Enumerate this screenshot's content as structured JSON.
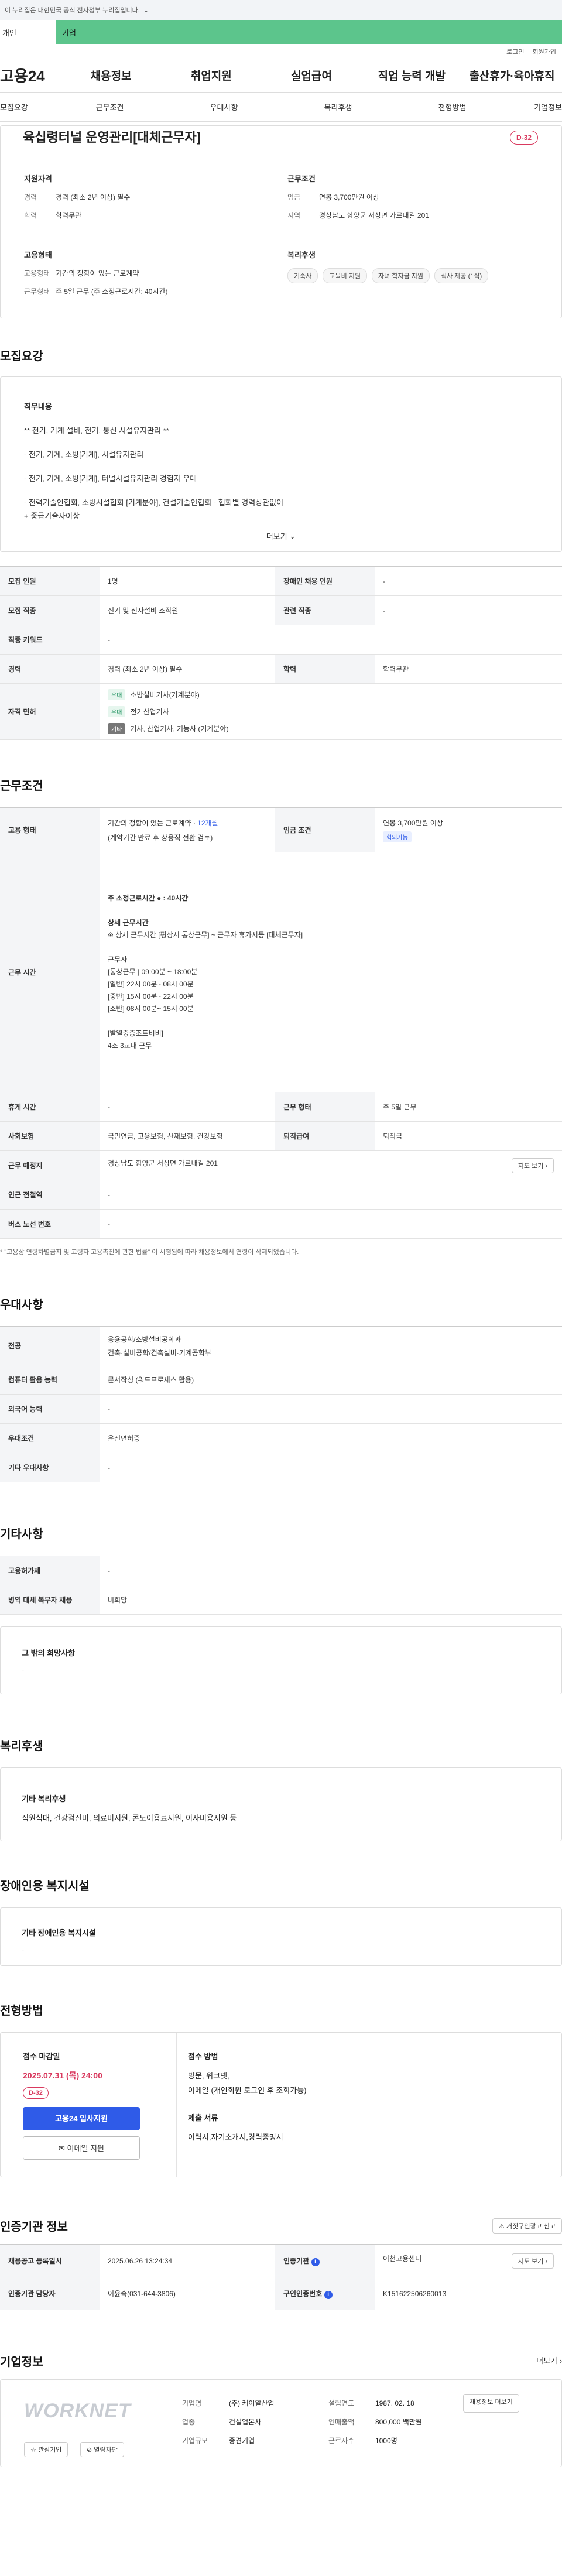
{
  "gov_banner": {
    "text": "이 누리집은 대한민국 공식 전자정부 누리집입니다.",
    "expand": "⌄"
  },
  "top_tabs": [
    "개인",
    "기업"
  ],
  "util": [
    "로그인",
    "회원가입"
  ],
  "logo": "고용24",
  "gnb": [
    "채용정보",
    "취업지원",
    "실업급여",
    "직업 능력 개발",
    "출산휴가·육아휴직"
  ],
  "subnav": [
    "모집요강",
    "근무조건",
    "우대사항",
    "복리후생",
    "전형방법",
    "기업정보"
  ],
  "summary": {
    "title": "육십령터널 운영관리[대체근무자]",
    "dday": "D-32",
    "qual": {
      "heading": "지원자격",
      "career_k": "경력",
      "career_v": "경력 (최소 2년 이상) 필수",
      "edu_k": "학력",
      "edu_v": "학력무관"
    },
    "cond": {
      "heading": "근무조건",
      "wage_k": "임금",
      "wage_v": "연봉 3,700만원 이상",
      "area_k": "지역",
      "area_v": "경상남도 함양군 서상면 가르내길 201"
    },
    "emp": {
      "heading": "고용형태",
      "type_k": "고용형태",
      "type_v": "기간의 정함이 있는 근로계약",
      "form_k": "근무형태",
      "form_v": "주 5일 근무 (주 소정근로시간: 40시간)"
    },
    "welfare": {
      "heading": "복리후생",
      "chips": [
        "기숙사",
        "교육비 지원",
        "자녀 학자금 지원",
        "식사 제공 (1식)"
      ]
    }
  },
  "desc": {
    "title": "모집요강",
    "heading": "직무내용",
    "lines": [
      "** 전기, 기계 설비, 전기, 통신 시설유지관리 **",
      "- 전기, 기계, 소방[기계], 시설유지관리",
      "- 전기, 기계, 소방[기계], 터널시설유지관리 경험자 우대",
      "- 전력기술인협회, 소방시설협회 [기계분야], 건설기술인협회 - 협회별 경력상관없이",
      "+ 중급기술자이상"
    ],
    "more": "더보기"
  },
  "recruit": {
    "count_h": "모집 인원",
    "count_v": "1명",
    "dis_h": "장애인 채용 인원",
    "dis_v": "-",
    "job_h": "모집 직종",
    "job_v": "전기 및 전자설비 조작원",
    "rel_h": "관련 직종",
    "rel_v": "-",
    "kw_h": "직종 키워드",
    "kw_v": "-",
    "career_h": "경력",
    "career_v": "경력 (최소 2년 이상) 필수",
    "edu_h": "학력",
    "edu_v": "학력무관",
    "lic_h": "자격 면허",
    "licenses": [
      {
        "tag": "우대",
        "name": "소방설비기사(기계분야)"
      },
      {
        "tag": "우대",
        "name": "전기산업기사"
      },
      {
        "tag": "기타",
        "name": "기사, 산업기사, 기능사 (기계분야)"
      }
    ]
  },
  "work": {
    "title": "근무조건",
    "emp_h": "고용 형태",
    "emp_v1": "기간의 정함이 있는 근로계약 · ",
    "emp_months": "12개월",
    "emp_v2": "(계약기간 만료 후 상용직 전환 검토)",
    "wage_h": "임금 조건",
    "wage_v": "연봉 3,700만원 이상",
    "wage_badge": "협의가능",
    "time_h": "근무 시간",
    "time_lines": [
      "주 소정근로시간 ● : 40시간",
      "",
      "상세 근무시간",
      "※ 상세 근무시간 [평상시 통상근무] ~ 근무자 휴가시등 [대체근무자]",
      "",
      "근무자",
      "[통상근무 ] 09:00분 ~ 18:00분",
      "[일반] 22시 00분~ 08시 00분",
      "[중반] 15시 00분~ 22시 00분",
      "[조반] 08시 00분~ 15시 00분",
      "",
      "[발열중증조트비비]",
      "4조 3교대 근무"
    ],
    "rest_h": "휴게 시간",
    "rest_v": "-",
    "form_h": "근무 형태",
    "form_v": "주 5일 근무",
    "ins_h": "사회보험",
    "ins_v": "국민연금, 고용보험, 산재보험, 건강보험",
    "ret_h": "퇴직급여",
    "ret_v": "퇴직금",
    "place_h": "근무 예정지",
    "place_v": "경상남도 함양군 서상면 가르내길 201",
    "map_btn": "지도 보기",
    "station_h": "인근 전철역",
    "station_v": "-",
    "bus_h": "버스 노선 번호",
    "bus_v": "-",
    "note": "* \"고용상 연령차별금지 및 고령자 고용촉진에 관한 법률\" 이 시행됨에 따라 채용정보에서 연령이 삭제되었습니다."
  },
  "pref": {
    "title": "우대사항",
    "major_h": "전공",
    "major_v1": "응용공학/소방설비공학과",
    "major_v2": "건축·설비공학/건축설비·기계공학부",
    "pc_h": "컴퓨터 활용 능력",
    "pc_v": "문서작성 (워드프로세스 활용)",
    "lang_h": "외국어 능력",
    "lang_v": "-",
    "cond_h": "우대조건",
    "cond_v": "운전면허증",
    "etc_h": "기타 우대사항",
    "etc_v": "-"
  },
  "other": {
    "title": "기타사항",
    "emp_h": "고용허가제",
    "emp_v": "-",
    "mil_h": "병역 대체 복무자 채용",
    "mil_v": "비희망",
    "wish_h": "그 밖의 희망사항",
    "wish_v": "-"
  },
  "welfare": {
    "title": "복리후생",
    "h": "기타 복리후생",
    "v": "직원식대, 건강검진비, 의료비지원, 콘도이용료지원, 이사비용지원 등"
  },
  "disabled": {
    "title": "장애인용 복지시설",
    "h": "기타 장애인용 복지시설",
    "v": "-"
  },
  "apply": {
    "title": "전형방법",
    "deadline_h": "접수 마감일",
    "deadline_v": "2025.07.31 (목) 24:00",
    "dday": "D-32",
    "apply_btn": "고용24 입사지원",
    "email_btn": "이메일 지원",
    "method_h": "접수 방법",
    "method_lines": [
      "방문, 워크넷,",
      "이메일 (개인회원 로그인 후 조회가능)"
    ],
    "docs_h": "제출 서류",
    "docs_v": "이력서,자기소개서,경력증명서"
  },
  "agency": {
    "title": "인증기관 정보",
    "report_btn": "거짓구인광고 신고",
    "reg_h": "채용공고 등록일시",
    "reg_v": "2025.06.26 13:24:34",
    "org_h": "인증기관",
    "org_v": "이천고용센터",
    "map_btn": "지도 보기",
    "mgr_h": "인증기관 담당자",
    "mgr_v": "이윤숙(031-644-3806)",
    "no_h": "구인인증번호",
    "no_v": "K151622506260013"
  },
  "company": {
    "title": "기업정보",
    "more": "더보기",
    "logo_text": "WORKNET",
    "fav_btn": "관심기업",
    "block_btn": "열람차단",
    "name_k": "기업명",
    "name_v": "(주) 케이알산업",
    "est_k": "설립연도",
    "est_v": "1987. 02. 18",
    "list_btn": "채용정보 더보기",
    "ind_k": "업종",
    "ind_v": "건설업본사",
    "sales_k": "연매출액",
    "sales_v": "800,000 백만원",
    "size_k": "기업규모",
    "size_v": "중견기업",
    "emp_k": "근로자수",
    "emp_v": "1000명"
  },
  "colors": {
    "accent": "#2f5be8",
    "dday": "#d9395e",
    "tab_active": "#5cc58c"
  }
}
